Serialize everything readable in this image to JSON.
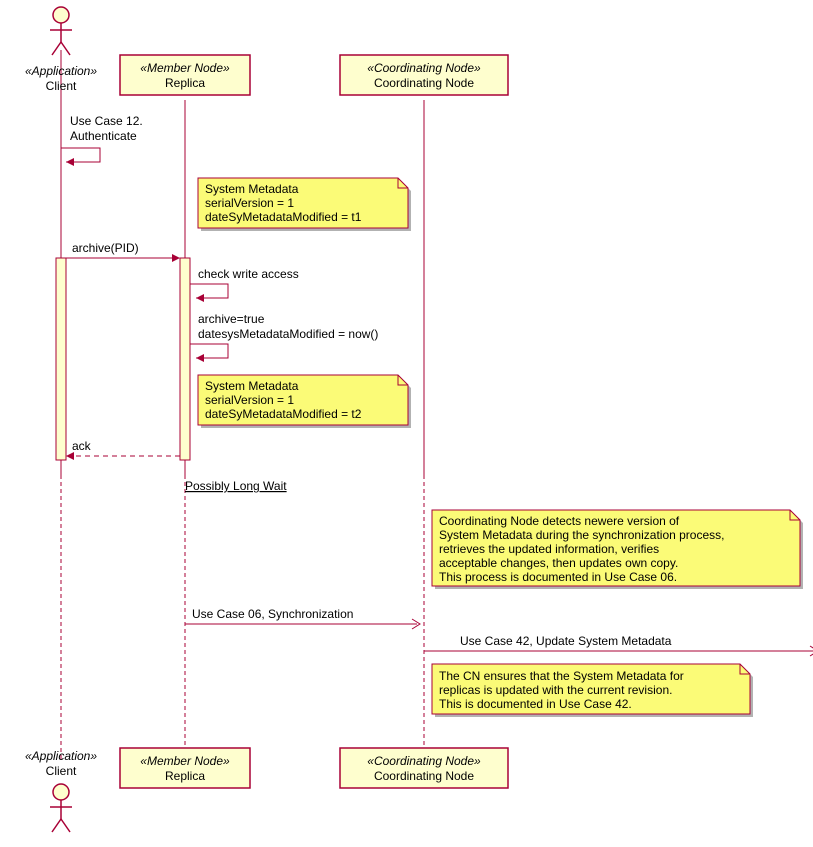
{
  "participants": {
    "client": {
      "stereotype": "«Application»",
      "name": "Client"
    },
    "replica": {
      "stereotype": "«Member Node»",
      "name": "Replica"
    },
    "cn": {
      "stereotype": "«Coordinating Node»",
      "name": "Coordinating Node"
    }
  },
  "messages": {
    "auth1": "Use Case 12.",
    "auth2": "Authenticate",
    "archive": "archive(PID)",
    "check": "check write access",
    "set1": "archive=true",
    "set2": "datesysMetadataModified = now()",
    "ack": "ack",
    "sync": "Use Case 06, Synchronization",
    "update": "Use Case 42, Update System Metadata"
  },
  "notes": {
    "sm1a": "System Metadata",
    "sm1b": "serialVersion = 1",
    "sm1c": "dateSyMetadataModified = t1",
    "sm2a": "System Metadata",
    "sm2b": "serialVersion = 1",
    "sm2c": "dateSyMetadataModified = t2",
    "cn1a": "Coordinating Node detects newere version of",
    "cn1b": "System Metadata during the synchronization process,",
    "cn1c": "retrieves the updated information, verifies",
    "cn1d": "acceptable changes, then updates own copy.",
    "cn1e": "This process is documented in Use Case 06.",
    "cn2a": "The CN ensures that the System Metadata for",
    "cn2b": "replicas is updated with the current revision.",
    "cn2c": "This is documented in Use Case 42."
  },
  "divider": "Possibly Long Wait",
  "chart_data": {
    "type": "sequence_diagram",
    "participants": [
      {
        "id": "Client",
        "stereotype": "Application",
        "kind": "actor"
      },
      {
        "id": "Replica",
        "stereotype": "Member Node",
        "kind": "participant"
      },
      {
        "id": "Coordinating Node",
        "stereotype": "Coordinating Node",
        "kind": "participant"
      }
    ],
    "interactions": [
      {
        "from": "Client",
        "to": "Client",
        "label": "Use Case 12. Authenticate",
        "type": "self"
      },
      {
        "note_over": "Replica",
        "text": "System Metadata serialVersion = 1 dateSyMetadataModified = t1"
      },
      {
        "from": "Client",
        "to": "Replica",
        "label": "archive(PID)",
        "activates": [
          "Client",
          "Replica"
        ]
      },
      {
        "from": "Replica",
        "to": "Replica",
        "label": "check write access",
        "type": "self"
      },
      {
        "from": "Replica",
        "to": "Replica",
        "label": "archive=true datesysMetadataModified = now()",
        "type": "self"
      },
      {
        "note_over": "Replica",
        "text": "System Metadata serialVersion = 1 dateSyMetadataModified = t2"
      },
      {
        "from": "Replica",
        "to": "Client",
        "label": "ack",
        "type": "return",
        "deactivates": [
          "Client",
          "Replica"
        ]
      },
      {
        "divider": "Possibly Long Wait"
      },
      {
        "note_over": "Coordinating Node",
        "text": "Coordinating Node detects newere version of System Metadata during the synchronization process, retrieves the updated information, verifies acceptable changes, then updates own copy. This process is documented in Use Case 06."
      },
      {
        "from": "Replica",
        "to": "Coordinating Node",
        "label": "Use Case 06, Synchronization"
      },
      {
        "from": "Coordinating Node",
        "to": "endpoint",
        "label": "Use Case 42, Update System Metadata"
      },
      {
        "note_over": "Coordinating Node",
        "text": "The CN ensures that the System Metadata for replicas is updated with the current revision. This is documented in Use Case 42."
      }
    ]
  }
}
